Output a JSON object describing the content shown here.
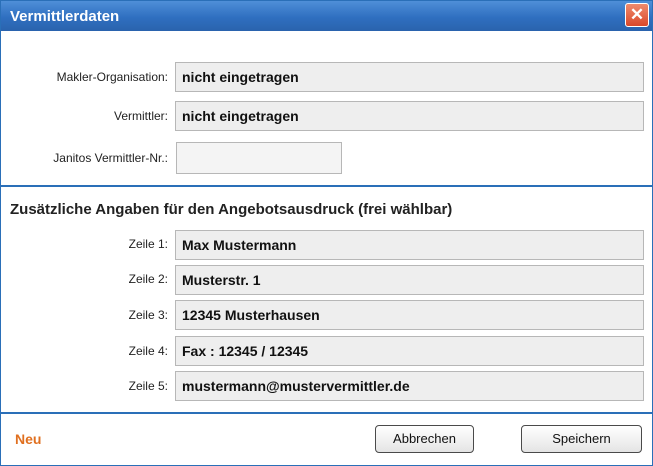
{
  "window": {
    "title": "Vermittlerdaten",
    "close_glyph": "✕"
  },
  "vermittler": {
    "org_label": "Makler-Organisation:",
    "org_value": "nicht eingetragen",
    "vermittler_label": "Vermittler:",
    "vermittler_value": "nicht eingetragen",
    "nr_label": "Janitos Vermittler-Nr.:",
    "nr_value": ""
  },
  "angebot": {
    "section_title": "Zusätzliche Angaben für den Angebotsausdruck (frei wählbar)",
    "lines": [
      {
        "label": "Zeile 1:",
        "value": "Max Mustermann"
      },
      {
        "label": "Zeile 2:",
        "value": "Musterstr. 1"
      },
      {
        "label": "Zeile 3:",
        "value": "12345 Musterhausen"
      },
      {
        "label": "Zeile 4:",
        "value": "Fax : 12345 / 12345"
      },
      {
        "label": "Zeile 5:",
        "value": "mustermann@mustervermittler.de"
      }
    ]
  },
  "footer": {
    "status": "Neu",
    "cancel_label": "Abbrechen",
    "save_label": "Speichern"
  },
  "colors": {
    "title_bar": "#2f6fc0",
    "close": "#d9482a",
    "status": "#e07020"
  }
}
